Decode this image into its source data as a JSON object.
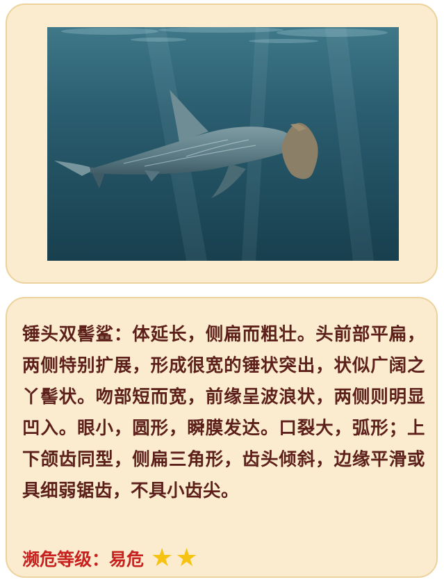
{
  "photo": {
    "subject": "hammerhead-shark-underwater",
    "colors": {
      "water_top": "#3d7486",
      "water_bottom": "#1a4150",
      "shark_body": "#6f8d95"
    }
  },
  "description": {
    "text": "锤头双髻鲨：体延长，侧扁而粗壮。头前部平扁，两侧特别扩展，形成很宽的锤状突出，状似广阔之丫髻状。吻部短而宽，前缘呈波浪状，两侧则明显凹入。眼小，圆形，瞬膜发达。口裂大，弧形；上下颌齿同型，侧扁三角形，齿头倾斜，边缘平滑或具细弱锯齿，不具小齿尖。"
  },
  "status": {
    "label": "濒危等级：",
    "value": "易危",
    "stars": 2,
    "star_glyph": "★",
    "star_color": "#f7c312",
    "text_color": "#c8201e"
  },
  "colors": {
    "card_bg": "#fbeccf",
    "card_border": "#ecd29c",
    "body_text": "#5c1f1a"
  }
}
